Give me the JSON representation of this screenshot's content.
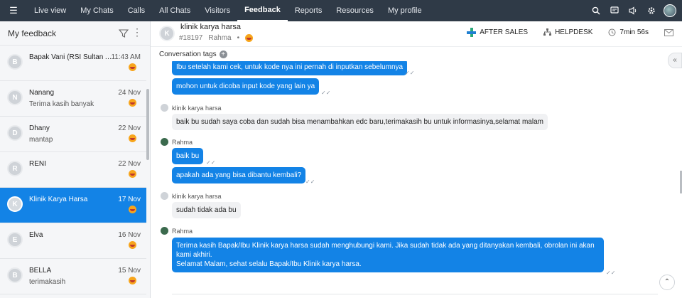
{
  "nav": {
    "tabs": [
      "Live view",
      "My Chats",
      "Calls",
      "All Chats",
      "Visitors",
      "Feedback",
      "Reports",
      "Resources",
      "My profile"
    ],
    "active": "Feedback",
    "icons": [
      "menu-icon",
      "search-icon",
      "chat-icon",
      "speaker-icon",
      "gear-icon",
      "avatar"
    ]
  },
  "sidebar": {
    "title": "My feedback",
    "items": [
      {
        "initial": "B",
        "name": "Bapak Vani (RSI Sultan A...",
        "sub": "",
        "time": "11:43 AM"
      },
      {
        "initial": "N",
        "name": "Nanang",
        "sub": "Terima kasih banyak",
        "time": "24 Nov"
      },
      {
        "initial": "D",
        "name": "Dhany",
        "sub": "mantap",
        "time": "22 Nov"
      },
      {
        "initial": "R",
        "name": "RENI",
        "sub": "",
        "time": "22 Nov"
      },
      {
        "initial": "K",
        "name": "Klinik Karya Harsa",
        "sub": "",
        "time": "17 Nov"
      },
      {
        "initial": "E",
        "name": "Elva",
        "sub": "",
        "time": "16 Nov"
      },
      {
        "initial": "B",
        "name": "BELLA",
        "sub": "terimakasih",
        "time": "15 Nov"
      }
    ],
    "selected_index": 4
  },
  "chat": {
    "initial": "K",
    "name": "klinik karya harsa",
    "id": "#18197",
    "agent": "Rahma",
    "dept1": "AFTER SALES",
    "dept2": "HELPDESK",
    "duration": "7min 56s",
    "tags_label": "Conversation tags"
  },
  "messages": {
    "m1": "Ibu setelah kami cek, untuk kode nya ini pernah di inputkan sebelumnya",
    "m2": "mohon untuk dicoba input kode yang lain ya",
    "s1": "klinik karya harsa",
    "m3": "baik bu sudah saya coba dan sudah bisa menambahkan edc baru,terimakasih bu untuk informasinya,selamat malam",
    "s2": "Rahma",
    "m4": "baik bu",
    "m5": "apakah ada yang bisa dibantu kembali?",
    "s3": "klinik karya harsa",
    "m6": "sudah tidak ada bu",
    "s4": "Rahma",
    "m7a": "Terima kasih Bapak/Ibu Klinik karya harsa sudah menghubungi kami. Jika sudah tidak ada yang ditanyakan kembali, obrolan ini akan",
    "m7b": "kami akhiri.",
    "m7c": "Selamat Malam, sehat selalu Bapak/Ibu Klinik karya harsa."
  }
}
